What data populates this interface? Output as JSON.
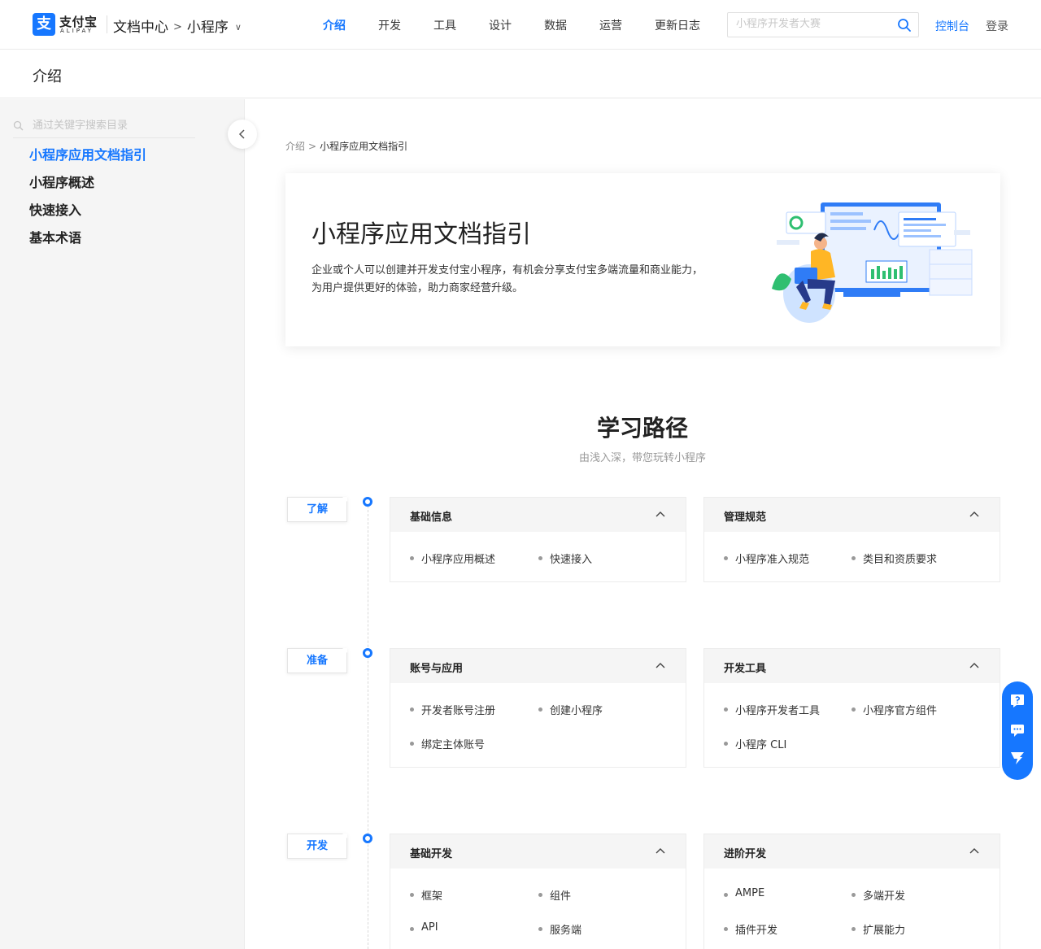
{
  "header": {
    "logo_cn": "支付宝",
    "logo_en": "ALIPAY",
    "doc_center": "文档中心",
    "product": "小程序",
    "nav": [
      {
        "label": "介绍",
        "active": true
      },
      {
        "label": "开发",
        "active": false
      },
      {
        "label": "工具",
        "active": false
      },
      {
        "label": "设计",
        "active": false
      },
      {
        "label": "数据",
        "active": false
      },
      {
        "label": "运营",
        "active": false
      },
      {
        "label": "更新日志",
        "active": false
      }
    ],
    "search_placeholder": "小程序开发者大赛",
    "console": "控制台",
    "login": "登录"
  },
  "subheader": {
    "title": "介绍"
  },
  "sidebar": {
    "search_placeholder": "通过关键字搜索目录",
    "items": [
      {
        "label": "小程序应用文档指引",
        "active": true
      },
      {
        "label": "小程序概述",
        "active": false
      },
      {
        "label": "快速接入",
        "active": false
      },
      {
        "label": "基本术语",
        "active": false
      }
    ]
  },
  "breadcrumb": {
    "parent": "介绍",
    "sep": ">",
    "current": "小程序应用文档指引"
  },
  "hero": {
    "title": "小程序应用文档指引",
    "desc_line1": "企业或个人可以创建并开发支付宝小程序，有机会分享支付宝多端流量和商业能力，",
    "desc_line2": "为用户提供更好的体验，助力商家经营升级。"
  },
  "learning": {
    "title": "学习路径",
    "subtitle": "由浅入深，带您玩转小程序",
    "stages": [
      {
        "tag": "了解",
        "cards": [
          {
            "title": "基础信息",
            "links": [
              "小程序应用概述",
              "快速接入"
            ]
          },
          {
            "title": "管理规范",
            "links": [
              "小程序准入规范",
              "类目和资质要求"
            ]
          }
        ]
      },
      {
        "tag": "准备",
        "cards": [
          {
            "title": "账号与应用",
            "links": [
              "开发者账号注册",
              "创建小程序",
              "绑定主体账号"
            ]
          },
          {
            "title": "开发工具",
            "links": [
              "小程序开发者工具",
              "小程序官方组件",
              "小程序 CLI"
            ]
          }
        ]
      },
      {
        "tag": "开发",
        "cards": [
          {
            "title": "基础开发",
            "links": [
              "框架",
              "组件",
              "API",
              "服务端"
            ]
          },
          {
            "title": "进阶开发",
            "links": [
              "AMPE",
              "多端开发",
              "插件开发",
              "扩展能力"
            ]
          }
        ]
      }
    ]
  },
  "colors": {
    "accent": "#1677ff",
    "sidebar_bg": "#f5f5f5",
    "card_head_bg": "#f5f5f5"
  },
  "icons": {
    "search": "search-icon",
    "chevron_down": "chevron-down-icon",
    "chevron_up": "chevron-up-icon",
    "collapse": "chevron-left-icon",
    "help": "help-icon",
    "chat": "chat-icon",
    "feedback": "feedback-icon"
  }
}
